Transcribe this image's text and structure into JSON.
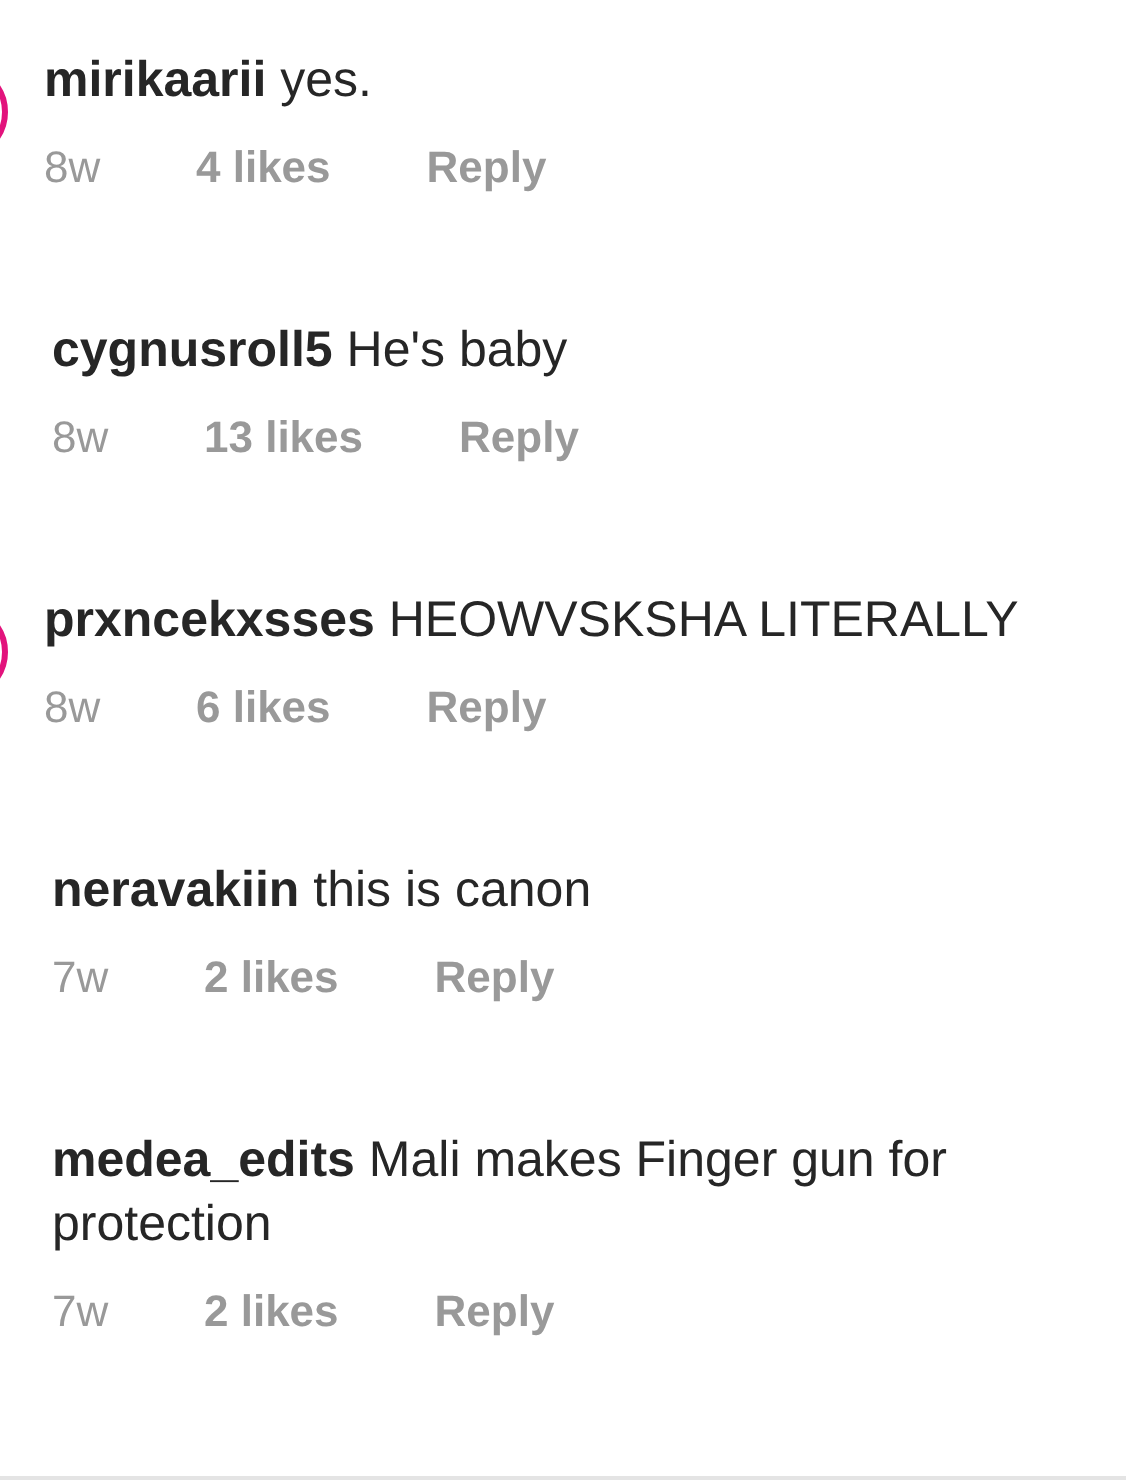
{
  "comments": [
    {
      "username": "mirikaarii",
      "text": "yes.",
      "age": "8w",
      "likes": "4 likes",
      "reply": "Reply",
      "story_ring": true
    },
    {
      "username": "cygnusroll5",
      "text": "He's baby",
      "age": "8w",
      "likes": "13 likes",
      "reply": "Reply",
      "story_ring": false
    },
    {
      "username": "prxncekxsses",
      "text": "HEOWVSKSHA LITERALLY",
      "age": "8w",
      "likes": "6 likes",
      "reply": "Reply",
      "story_ring": true
    },
    {
      "username": "neravakiin",
      "text": "this is canon",
      "age": "7w",
      "likes": "2 likes",
      "reply": "Reply",
      "story_ring": false
    },
    {
      "username": "medea_edits",
      "text": "Mali makes Finger gun for protection",
      "age": "7w",
      "likes": "2 likes",
      "reply": "Reply",
      "story_ring": false
    }
  ]
}
